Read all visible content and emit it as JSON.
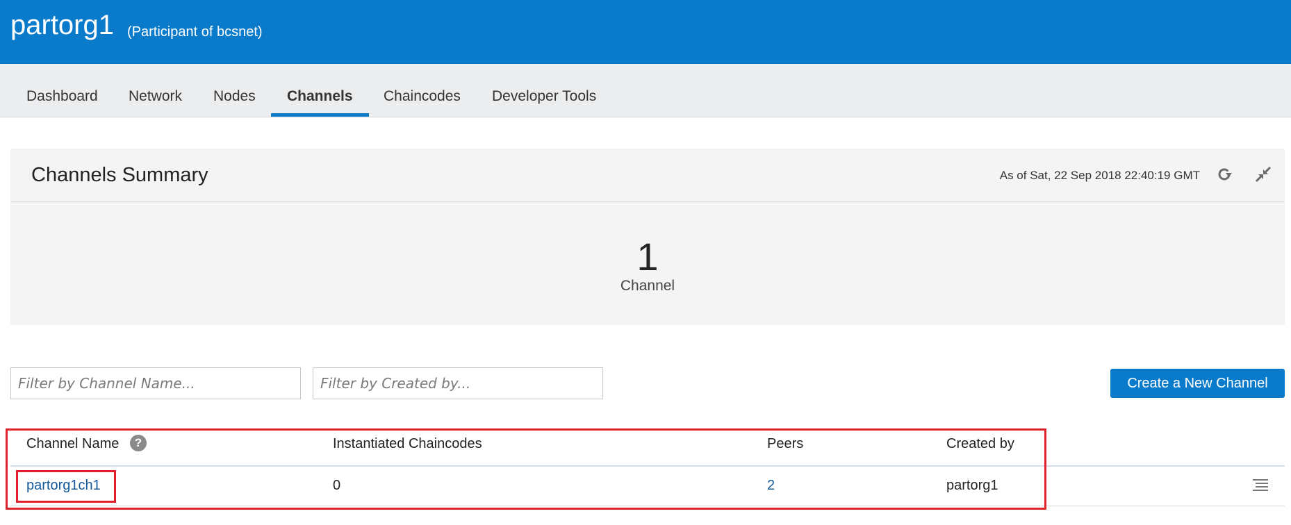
{
  "header": {
    "title": "partorg1",
    "subtitle": "(Participant of bcsnet)"
  },
  "nav": {
    "tabs": [
      {
        "label": "Dashboard",
        "active": false
      },
      {
        "label": "Network",
        "active": false
      },
      {
        "label": "Nodes",
        "active": false
      },
      {
        "label": "Channels",
        "active": true
      },
      {
        "label": "Chaincodes",
        "active": false
      },
      {
        "label": "Developer Tools",
        "active": false
      }
    ]
  },
  "summary": {
    "title": "Channels Summary",
    "as_of": "As of Sat, 22 Sep 2018 22:40:19 GMT",
    "count": "1",
    "count_label": "Channel",
    "icons": [
      "refresh-icon",
      "collapse-icon"
    ]
  },
  "filters": {
    "channel_name_placeholder": "Filter by Channel Name...",
    "created_by_placeholder": "Filter by Created by..."
  },
  "actions": {
    "create_label": "Create a New Channel"
  },
  "table": {
    "headers": [
      "Channel Name",
      "Instantiated Chaincodes",
      "Peers",
      "Created by"
    ],
    "help_icon": "?",
    "rows": [
      {
        "name": "partorg1ch1",
        "chaincodes": "0",
        "peers": "2",
        "created_by": "partorg1"
      }
    ]
  },
  "colors": {
    "brand": "#0a7bcb",
    "highlight": "#e0202b",
    "link": "#11579a"
  }
}
